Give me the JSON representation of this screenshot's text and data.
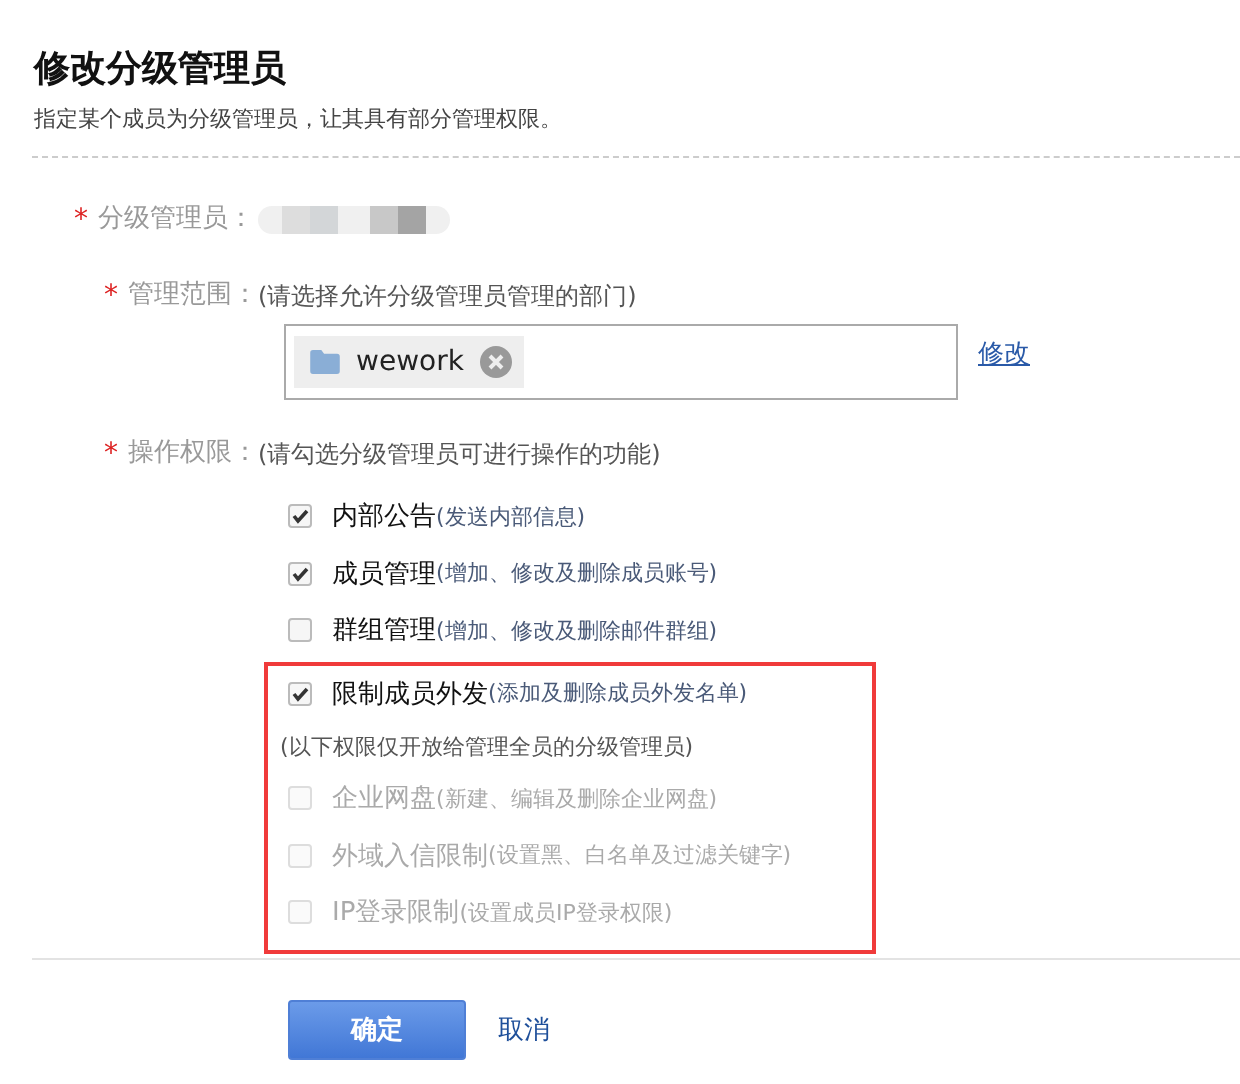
{
  "title": "修改分级管理员",
  "subtitle": "指定某个成员为分级管理员，让其具有部分管理权限。",
  "admin_field": {
    "required_mark": "*",
    "label": "分级管理员："
  },
  "scope_field": {
    "required_mark": "*",
    "label": "管理范围：",
    "hint": "(请选择允许分级管理员管理的部门)",
    "tags": [
      {
        "label": "wework"
      }
    ],
    "edit_link": "修改"
  },
  "permission_field": {
    "required_mark": "*",
    "label": "操作权限：",
    "hint": "(请勾选分级管理员可进行操作的功能)"
  },
  "permissions": [
    {
      "kind": "option",
      "label": "内部公告",
      "description": "(发送内部信息)",
      "checked": true,
      "disabled": false,
      "highlighted": false
    },
    {
      "kind": "option",
      "label": "成员管理",
      "description": "(增加、修改及删除成员账号)",
      "checked": true,
      "disabled": false,
      "highlighted": false
    },
    {
      "kind": "option",
      "label": "群组管理",
      "description": "(增加、修改及删除邮件群组)",
      "checked": false,
      "disabled": false,
      "highlighted": false
    },
    {
      "kind": "option",
      "label": "限制成员外发",
      "description": "(添加及删除成员外发名单)",
      "checked": true,
      "disabled": false,
      "highlighted": true
    },
    {
      "kind": "note",
      "label": "(以下权限仅开放给管理全员的分级管理员)",
      "highlighted": true
    },
    {
      "kind": "option",
      "label": "企业网盘",
      "description": "(新建、编辑及删除企业网盘)",
      "checked": false,
      "disabled": true,
      "highlighted": true
    },
    {
      "kind": "option",
      "label": "外域入信限制",
      "description": "(设置黑、白名单及过滤关键字)",
      "checked": false,
      "disabled": true,
      "highlighted": true
    },
    {
      "kind": "option",
      "label": "IP登录限制",
      "description": "(设置成员IP登录权限)",
      "checked": false,
      "disabled": true,
      "highlighted": true
    }
  ],
  "buttons": {
    "confirm": "确定",
    "cancel": "取消"
  }
}
